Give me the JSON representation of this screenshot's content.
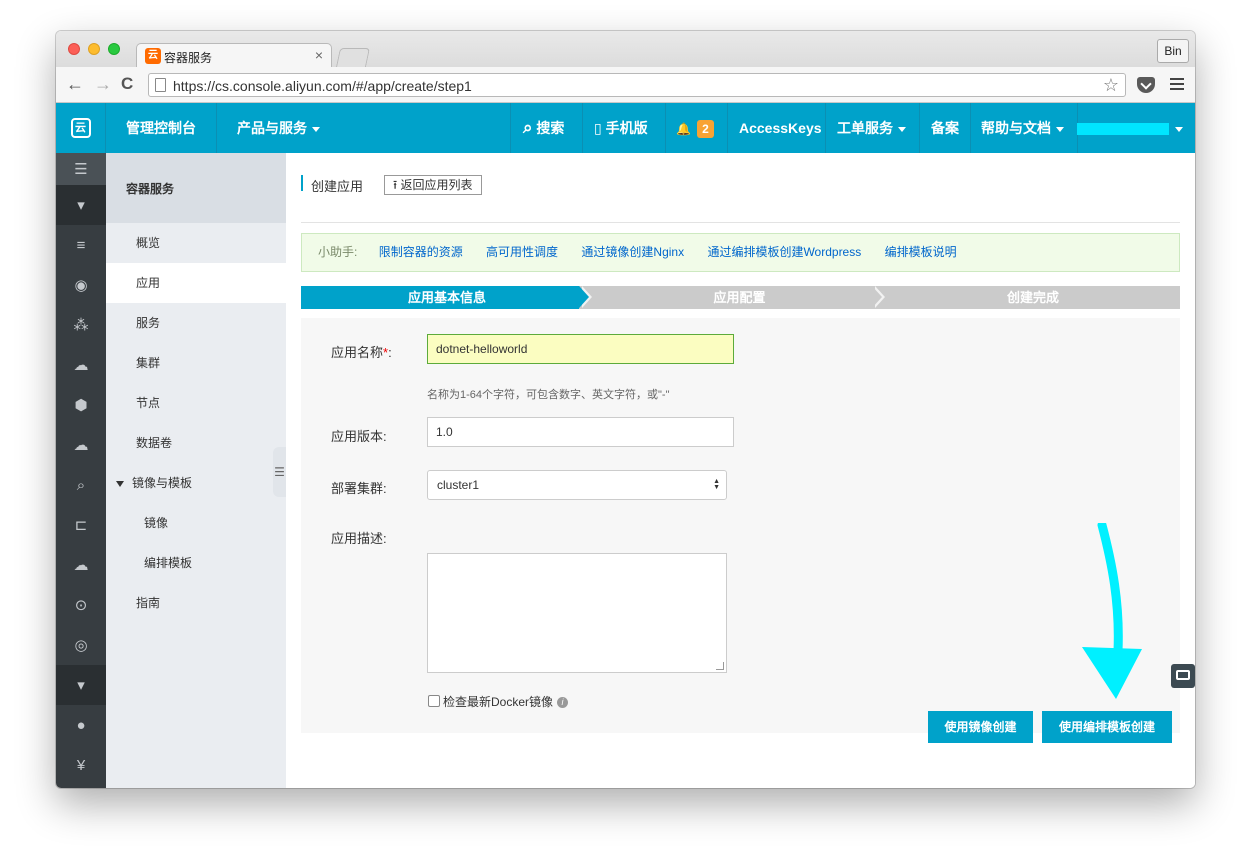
{
  "browser": {
    "tab_title": "容器服务",
    "tab_favicon_glyph": "云",
    "tab_close": "×",
    "profile_label": "Bin",
    "url": "https://cs.console.aliyun.com/#/app/create/step1",
    "back_glyph": "←",
    "forward_glyph": "→",
    "reload_glyph": "C",
    "star_glyph": "☆"
  },
  "header": {
    "logo_glyph": "云",
    "console": "管理控制台",
    "products": "产品与服务",
    "search": "搜索",
    "mobile": "手机版",
    "notification_count": "2",
    "access_keys": "AccessKeys",
    "ticket": "工单服务",
    "beian": "备案",
    "help": "帮助与文档",
    "search_icon": "⌕",
    "mobile_icon": "▯",
    "bell_icon": "🔔"
  },
  "rail": {
    "icons": [
      "☰",
      "▾",
      "≡",
      "◉",
      "⁂",
      "☁",
      "⬢",
      "☁",
      "⌕",
      "⊏",
      "☁",
      "⊙",
      "◎",
      "▾",
      "●",
      "¥"
    ]
  },
  "sidebar": {
    "title": "容器服务",
    "items": [
      {
        "label": "概览"
      },
      {
        "label": "应用"
      },
      {
        "label": "服务"
      },
      {
        "label": "集群"
      },
      {
        "label": "节点"
      },
      {
        "label": "数据卷"
      },
      {
        "label": "镜像与模板"
      },
      {
        "label": "镜像"
      },
      {
        "label": "编排模板"
      },
      {
        "label": "指南"
      }
    ],
    "collapse_glyph": "☰"
  },
  "main": {
    "title": "创建应用",
    "back_button": "⭱ 返回应用列表",
    "helper": {
      "label": "小助手:",
      "links": [
        "限制容器的资源",
        "高可用性调度",
        "通过镜像创建Nginx",
        "通过编排模板创建Wordpress",
        "编排模板说明"
      ]
    },
    "steps": [
      "应用基本信息",
      "应用配置",
      "创建完成"
    ],
    "form": {
      "name_label": "应用名称",
      "required_mark": "*",
      "name_label_suffix": ":",
      "name_value": "dotnet-helloworld",
      "name_hint": "名称为1-64个字符，可包含数字、英文字符，或\"-\"",
      "version_label": "应用版本:",
      "version_value": "1.0",
      "cluster_label": "部署集群:",
      "cluster_value": "cluster1",
      "desc_label": "应用描述:",
      "check_label": "检查最新Docker镜像",
      "info_glyph": "i"
    },
    "buttons": {
      "image_create": "使用镜像创建",
      "template_create": "使用编排模板创建"
    }
  },
  "colors": {
    "brand": "#00a2ca",
    "rail": "#373d41",
    "annotation_arrow": "#00f0ff"
  }
}
